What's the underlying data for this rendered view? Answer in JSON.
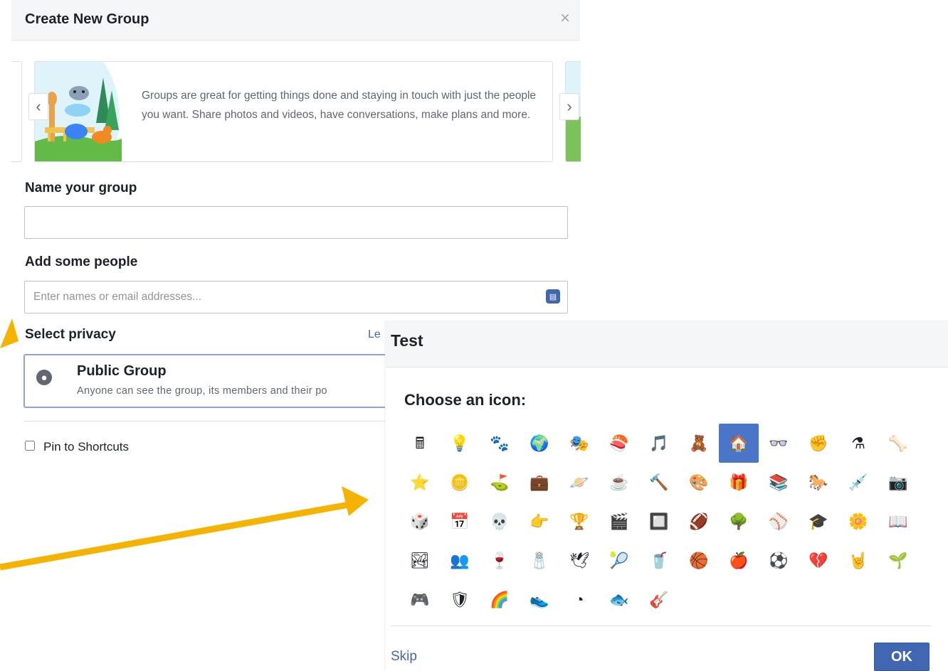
{
  "group_dialog": {
    "title": "Create New Group",
    "close_glyph": "×",
    "carousel": {
      "prev_glyph": "‹",
      "next_glyph": "›",
      "text": "Groups are great for getting things done and staying in touch with just the people you want. Share photos and videos, have conversations, make plans and more.",
      "illustration": "animals-group-illustration"
    },
    "name_label": "Name your group",
    "name_value": "",
    "people_label": "Add some people",
    "people_placeholder": "Enter names or email addresses...",
    "people_icon": "contacts-icon",
    "privacy_label": "Select privacy",
    "learn_more": "Le",
    "privacy": {
      "icon": "globe-icon",
      "title": "Public Group",
      "description": "Anyone can see the group, its members and their po"
    },
    "pin_label": "Pin to Shortcuts",
    "pin_checked": false
  },
  "icon_picker": {
    "title": "Test",
    "heading": "Choose an icon:",
    "selected_index": 8,
    "icons": [
      {
        "name": "calculator",
        "glyph": "🖩"
      },
      {
        "name": "lightbulb",
        "glyph": "💡"
      },
      {
        "name": "paw",
        "glyph": "🐾"
      },
      {
        "name": "earth",
        "glyph": "🌍"
      },
      {
        "name": "theater-masks",
        "glyph": "🎭"
      },
      {
        "name": "sushi",
        "glyph": "🍣"
      },
      {
        "name": "music-note",
        "glyph": "🎵"
      },
      {
        "name": "teddy-bear",
        "glyph": "🧸"
      },
      {
        "name": "house",
        "glyph": "🏠"
      },
      {
        "name": "glasses",
        "glyph": "👓"
      },
      {
        "name": "fist",
        "glyph": "✊"
      },
      {
        "name": "flask",
        "glyph": "⚗"
      },
      {
        "name": "bone",
        "glyph": "🦴"
      },
      {
        "name": "star-badge",
        "glyph": "⭐"
      },
      {
        "name": "coin",
        "glyph": "🪙"
      },
      {
        "name": "golf",
        "glyph": "⛳"
      },
      {
        "name": "briefcase",
        "glyph": "💼"
      },
      {
        "name": "planet",
        "glyph": "🪐"
      },
      {
        "name": "coffee-cup",
        "glyph": "☕"
      },
      {
        "name": "gavel",
        "glyph": "🔨"
      },
      {
        "name": "palette",
        "glyph": "🎨"
      },
      {
        "name": "gift",
        "glyph": "🎁"
      },
      {
        "name": "bookshelf",
        "glyph": "📚"
      },
      {
        "name": "horse",
        "glyph": "🐎"
      },
      {
        "name": "syringe",
        "glyph": "💉"
      },
      {
        "name": "camera",
        "glyph": "📷"
      },
      {
        "name": "dice",
        "glyph": "🎲"
      },
      {
        "name": "calendar",
        "glyph": "📅"
      },
      {
        "name": "skull",
        "glyph": "💀"
      },
      {
        "name": "pointing-hand",
        "glyph": "👉"
      },
      {
        "name": "trophy",
        "glyph": "🏆"
      },
      {
        "name": "clapperboard",
        "glyph": "🎬"
      },
      {
        "name": "chip",
        "glyph": "🔲"
      },
      {
        "name": "football",
        "glyph": "🏈"
      },
      {
        "name": "tree",
        "glyph": "🌳"
      },
      {
        "name": "baseball",
        "glyph": "⚾"
      },
      {
        "name": "graduation-cap",
        "glyph": "🎓"
      },
      {
        "name": "flower",
        "glyph": "🌼"
      },
      {
        "name": "open-book",
        "glyph": "📖"
      },
      {
        "name": "landscape",
        "glyph": "🏞"
      },
      {
        "name": "people",
        "glyph": "👥"
      },
      {
        "name": "wine-glass",
        "glyph": "🍷"
      },
      {
        "name": "salt-shaker",
        "glyph": "🧂"
      },
      {
        "name": "dove",
        "glyph": "🕊"
      },
      {
        "name": "tennis-racket",
        "glyph": "🎾"
      },
      {
        "name": "red-cup",
        "glyph": "🥤"
      },
      {
        "name": "basketball",
        "glyph": "🏀"
      },
      {
        "name": "apple",
        "glyph": "🍎"
      },
      {
        "name": "soccer-ball",
        "glyph": "⚽"
      },
      {
        "name": "broken-heart",
        "glyph": "💔"
      },
      {
        "name": "rock-hand",
        "glyph": "🤘"
      },
      {
        "name": "sprout",
        "glyph": "🌱"
      },
      {
        "name": "game-controller",
        "glyph": "🎮"
      },
      {
        "name": "shield",
        "glyph": "🛡"
      },
      {
        "name": "rainbow",
        "glyph": "🌈"
      },
      {
        "name": "sneaker",
        "glyph": "👟"
      },
      {
        "name": "pie-chart",
        "glyph": "◔"
      },
      {
        "name": "fish",
        "glyph": "🐟"
      },
      {
        "name": "guitar",
        "glyph": "🎸"
      }
    ],
    "skip_label": "Skip",
    "ok_label": "OK"
  },
  "colors": {
    "accent": "#4267b2",
    "selected_icon_bg": "#4a76c9",
    "annotation_arrow": "#f5b301"
  }
}
